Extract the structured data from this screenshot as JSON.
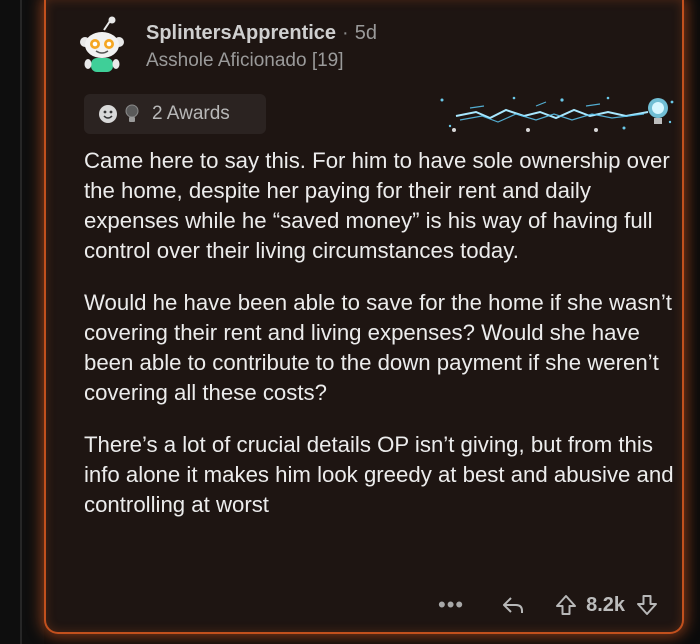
{
  "comment": {
    "author": "SplintersApprentice",
    "separator": "·",
    "age": "5d",
    "flair": "Asshole Aficionado [19]",
    "awards": {
      "label": "2 Awards",
      "icons": [
        "wholesome-face-award-icon",
        "lightbulb-award-icon"
      ]
    },
    "paragraphs": [
      "Came here to say this. For him to have sole ownership over the home, despite her paying for their rent and daily expenses while he “saved money” is his way of having full control over their living circumstances today.",
      "Would he have been able to save for the home if she wasn’t covering their rent and living expenses? Would she have been able to contribute to the down payment if she weren’t covering all these costs?",
      "There’s a lot of crucial details OP isn’t giving, but from this info alone it makes him look greedy at best and abusive and controlling at worst"
    ],
    "actions": {
      "more": "•••",
      "score": "8.2k"
    }
  },
  "colors": {
    "card_background": "#1e1512",
    "glow_border": "#c2501d",
    "text": "#ececec",
    "muted_text": "#9a9a9a"
  }
}
